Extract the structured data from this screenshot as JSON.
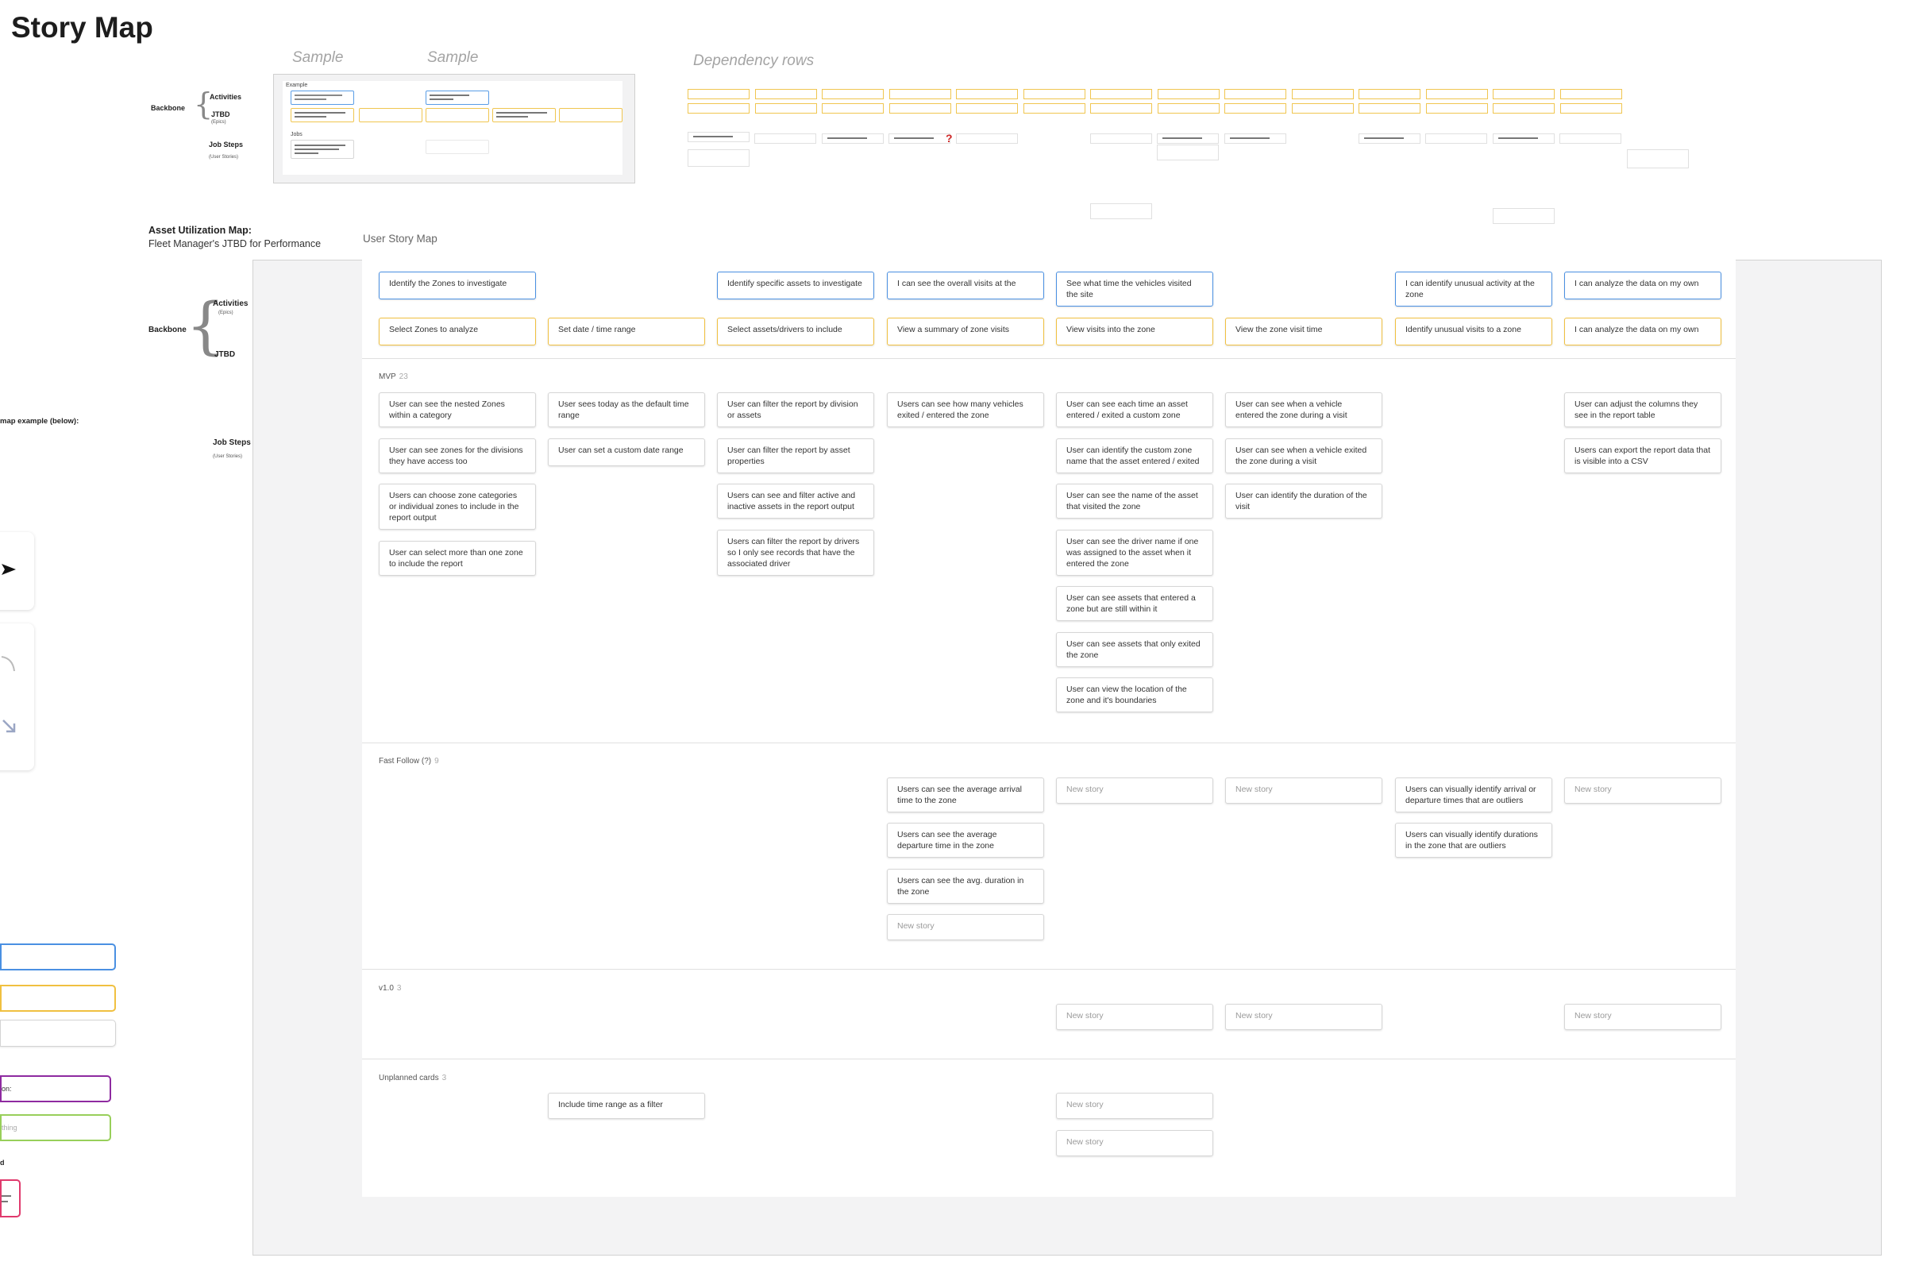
{
  "title": "Story Map",
  "sample": {
    "label_1": "Sample",
    "label_2": "Sample",
    "example_text": "Example",
    "row_label": "Jobs"
  },
  "dependency": {
    "label": "Dependency rows",
    "question": "?"
  },
  "mini_legend": {
    "backbone": "Backbone",
    "activities": "Activities",
    "jtbd": "JTBD",
    "jtbd_sub": "(Epics)",
    "job_steps": "Job Steps",
    "job_steps_sub": "(User Stories)"
  },
  "legend": {
    "backbone": "Backbone",
    "activities": "Activities",
    "activities_sub": "(Epics)",
    "jtbd": "JTBD",
    "job_steps": "Job Steps",
    "job_steps_sub": "(User Stories)",
    "map_example": "map example (below):",
    "option_label": "on:",
    "thing_label": "thing",
    "d_label": "d"
  },
  "asset_map": {
    "title": "Asset Utilization Map:",
    "subtitle": "Fleet Manager's JTBD for Performance"
  },
  "board": {
    "heading": "User Story Map",
    "activities": [
      "Identify the Zones to investigate",
      "Identify specific assets to investigate",
      "I can see the overall visits at the",
      "See what time the vehicles visited the site",
      "I can identify unusual activity at the zone",
      "I can analyze the data on my own"
    ],
    "jtbd": [
      "Select Zones to analyze",
      "Set date / time range",
      "Select assets/drivers to include",
      "View a summary of zone visits",
      "View visits into the zone",
      "View the zone visit time",
      "Identify unusual visits to a zone",
      "I can analyze the data on my own"
    ],
    "releases": [
      {
        "name": "MVP",
        "count": "23"
      },
      {
        "name": "Fast Follow (?)",
        "count": "9"
      },
      {
        "name": "v1.0",
        "count": "3"
      },
      {
        "name": "Unplanned cards",
        "count": "3"
      }
    ],
    "mvp": {
      "c1": [
        "User can see the nested Zones within a category",
        "User can see zones for the divisions they have access too",
        "Users can choose zone categories or individual zones to include in the report output",
        "User can select more than one zone to include the report"
      ],
      "c2": [
        "User sees today as the default time range",
        "User can set a custom date range"
      ],
      "c3": [
        "User can filter the report by division or assets",
        "User can filter the report by asset properties",
        "Users can see and filter active and inactive assets in the report output",
        "Users can filter the report by drivers so I only see records that have the associated driver"
      ],
      "c4": [
        "Users can see how many vehicles exited / entered the zone"
      ],
      "c5": [
        "User can see each time an asset entered / exited a custom zone",
        "User can identify the custom zone name that the asset entered / exited",
        "User can see the name of the asset that visited the zone",
        "User can see the driver name if one was assigned to the asset when it entered the zone",
        "User can see assets that entered a zone but are still within it",
        "User can see assets that only exited the zone",
        "User can view the location of the zone and it's boundaries"
      ],
      "c6": [
        "User can see when a vehicle entered the zone during a visit",
        "User can see when a vehicle exited the zone during a visit",
        "User can identify the duration of the visit"
      ],
      "c8": [
        "User can adjust the columns they see in the report table",
        "Users can export the report data that is visible into a CSV"
      ]
    },
    "fast_follow": {
      "c4": [
        "Users can see the average arrival time to the zone",
        "Users can see the average departure time in the zone",
        "Users can see the avg. duration in the zone",
        "New story"
      ],
      "c5": [
        "New story"
      ],
      "c6": [
        "New story"
      ],
      "c7": [
        "Users can visually identify arrival or departure times that are outliers",
        "Users can visually identify durations in the zone that are outliers"
      ],
      "c8": [
        "New story"
      ]
    },
    "v1": {
      "c5": [
        "New story"
      ],
      "c6": [
        "New story"
      ],
      "c8": [
        "New story"
      ]
    },
    "unplanned": {
      "c2": [
        "Include time range as a filter"
      ],
      "c5": [
        "New story",
        "New story"
      ]
    }
  },
  "colors": {
    "activity_border": "#4a90e2",
    "jtbd_border": "#f0c040",
    "purple": "#8e2aa0",
    "green": "#98cf5a",
    "pink": "#e03a6d"
  }
}
